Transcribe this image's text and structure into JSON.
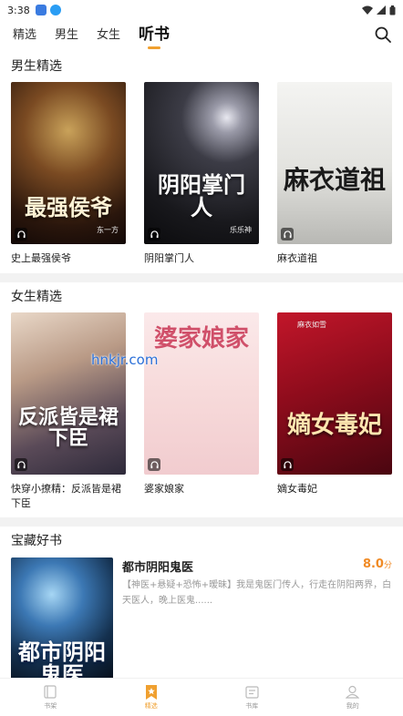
{
  "status_bar": {
    "time": "3:38"
  },
  "nav": {
    "tabs": [
      {
        "label": "精选"
      },
      {
        "label": "男生"
      },
      {
        "label": "女生"
      },
      {
        "label": "听书"
      }
    ],
    "active_tab": "听书"
  },
  "sections": {
    "male": {
      "title": "男生精选",
      "books": [
        {
          "title": "史上最强侯爷",
          "cover_text": "最强侯爷",
          "cover_author": "东一方"
        },
        {
          "title": "阴阳掌门人",
          "cover_text": "阴阳掌门人",
          "cover_author": "乐乐神"
        },
        {
          "title": "麻衣道祖",
          "cover_text": "麻衣道祖",
          "cover_author": ""
        }
      ]
    },
    "female": {
      "title": "女生精选",
      "books": [
        {
          "title": "快穿小撩精：反派皆是裙下臣",
          "cover_text": "反派皆是裙下臣",
          "cover_author": ""
        },
        {
          "title": "婆家娘家",
          "cover_text": "婆家娘家",
          "cover_author": ""
        },
        {
          "title": "嫡女毒妃",
          "cover_text": "嫡女毒妃",
          "cover_author": "麻衣如雪"
        }
      ]
    },
    "treasure": {
      "title": "宝藏好书",
      "featured": {
        "title": "都市阴阳鬼医",
        "score": "8.0",
        "score_unit": "分",
        "description": "【神医+悬疑+恐怖+暧昧】我是鬼医门传人，行走在阴阳两界，白天医人，晚上医鬼......",
        "cover_text": "都市阴阳鬼医"
      }
    }
  },
  "watermark": "hnkjr.com",
  "bottom_nav": {
    "items": [
      {
        "label": "书架",
        "icon": "book-icon"
      },
      {
        "label": "精选",
        "icon": "star-bookmark-icon"
      },
      {
        "label": "书库",
        "icon": "library-icon"
      },
      {
        "label": "我的",
        "icon": "user-icon"
      }
    ]
  },
  "colors": {
    "accent": "#f0a030",
    "score": "#f08a24",
    "divider": "#f2f2f2"
  }
}
